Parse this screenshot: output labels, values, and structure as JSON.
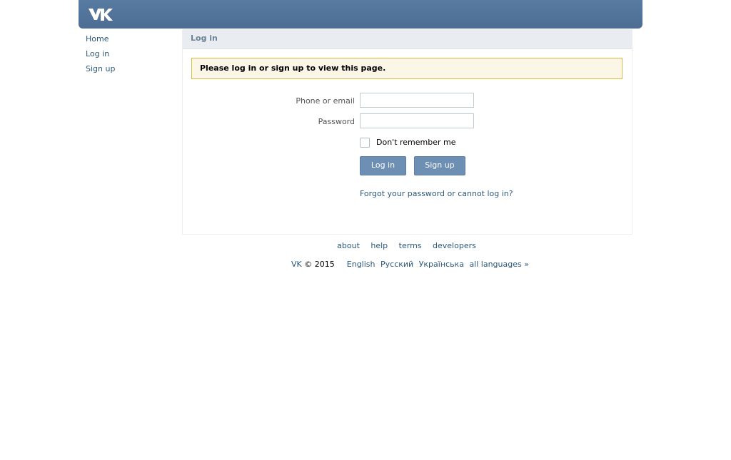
{
  "brand": {
    "logo_text": "VK",
    "header_color": "#587ba2"
  },
  "sidebar": {
    "items": [
      {
        "label": "Home"
      },
      {
        "label": "Log in"
      },
      {
        "label": "Sign up"
      }
    ]
  },
  "panel": {
    "title": "Log in",
    "notice": "Please log in or sign up to view this page.",
    "phone_label": "Phone or email",
    "phone_value": "",
    "password_label": "Password",
    "password_value": "",
    "remember_label": "Don't remember me",
    "login_button": "Log in",
    "signup_button": "Sign up",
    "forgot_link": "Forgot your password or cannot log in?"
  },
  "footer": {
    "links": [
      "about",
      "help",
      "terms",
      "developers"
    ],
    "brand": "VK",
    "copyright": "© 2015",
    "languages": [
      "English",
      "Русский",
      "Українська",
      "all languages »"
    ]
  }
}
